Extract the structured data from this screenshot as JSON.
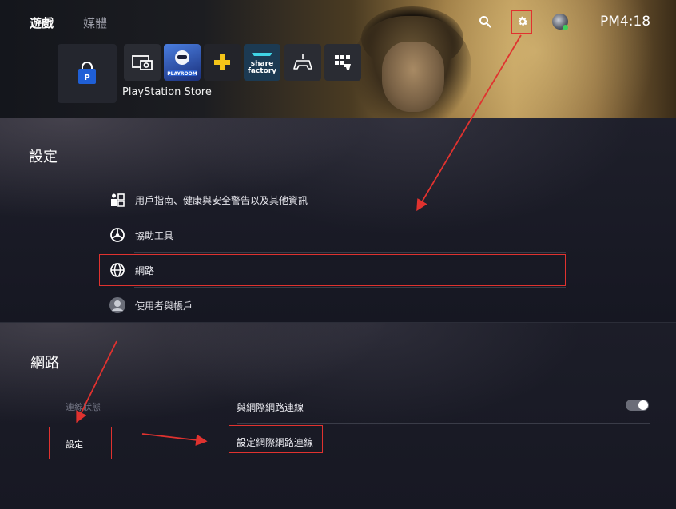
{
  "home": {
    "tabs": [
      {
        "label": "遊戲",
        "active": true
      },
      {
        "label": "媒體",
        "active": false
      }
    ],
    "clock": "PM4:18",
    "top_icons": [
      "search-icon",
      "gear-icon",
      "avatar"
    ],
    "tiles": [
      {
        "name": "playstation-store",
        "caption": "PlayStation Store"
      },
      {
        "name": "media-gallery"
      },
      {
        "name": "astros-playroom",
        "text": "PLAYROOM"
      },
      {
        "name": "playstation-plus"
      },
      {
        "name": "share-factory",
        "text_lines": [
          "share",
          "factory"
        ]
      },
      {
        "name": "game-base"
      },
      {
        "name": "controller-tiles"
      }
    ],
    "store_caption": "PlayStation Store"
  },
  "settings": {
    "title": "設定",
    "items": [
      {
        "label": "用戶指南、健康與安全警告以及其他資訊",
        "icon": "info-icon"
      },
      {
        "label": "協助工具",
        "icon": "accessibility-icon"
      },
      {
        "label": "網路",
        "icon": "globe-icon"
      },
      {
        "label": "使用者與帳戶",
        "icon": "avatar-icon"
      }
    ]
  },
  "network": {
    "title": "網路",
    "left_items": [
      {
        "label": "連線狀態",
        "active": false
      },
      {
        "label": "設定",
        "active": true
      }
    ],
    "rows": [
      {
        "label": "與網際網路連線",
        "toggle": true
      },
      {
        "label": "設定網際網路連線"
      }
    ]
  },
  "colors": {
    "annotation": "#e0322f",
    "toggle_track": "#6b6d78",
    "online_dot": "#3ecf5a",
    "store_blue": "#1f5fd6"
  }
}
